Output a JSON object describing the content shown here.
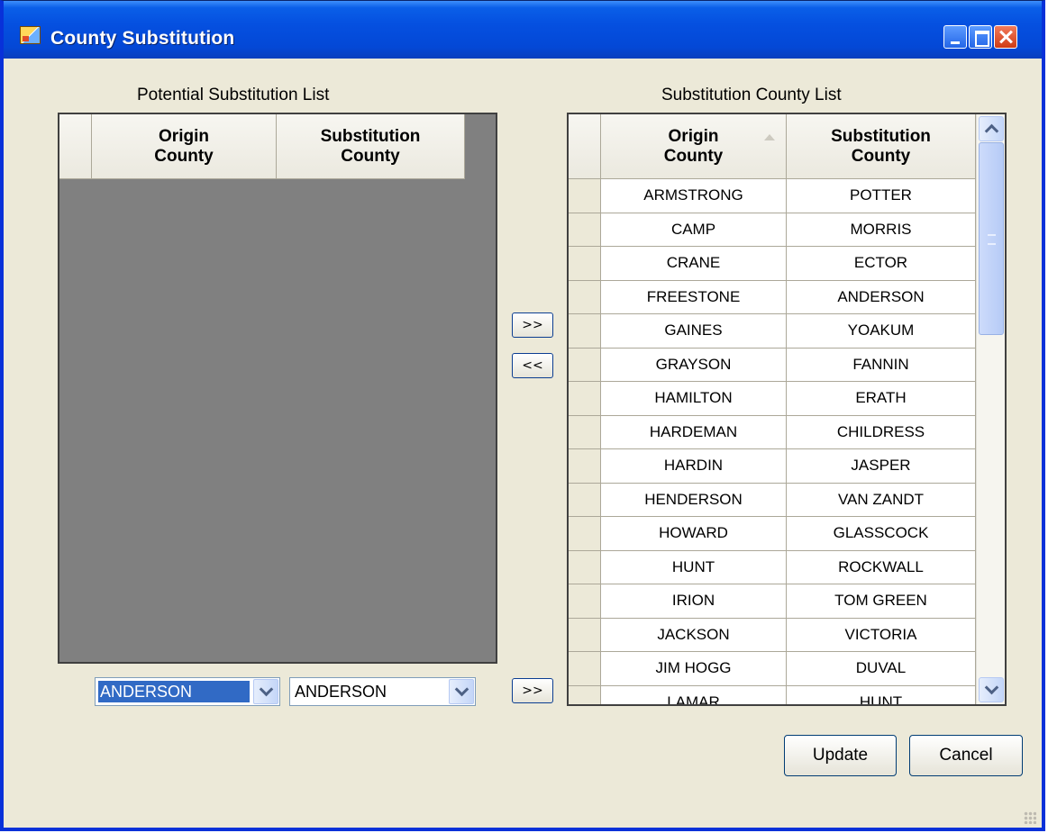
{
  "window": {
    "title": "County Substitution",
    "buttons": [
      "minimize-icon",
      "maximize-icon",
      "close-icon"
    ]
  },
  "left_panel": {
    "title": "Potential Substitution List",
    "columns": [
      "Origin\nCounty",
      "Substitution\nCounty"
    ],
    "rows": []
  },
  "right_panel": {
    "title": "Substitution County List",
    "columns": [
      "Origin\nCounty",
      "Substitution\nCounty"
    ],
    "sorted_column": "Origin County",
    "rows": [
      [
        "ARMSTRONG",
        "POTTER"
      ],
      [
        "CAMP",
        "MORRIS"
      ],
      [
        "CRANE",
        "ECTOR"
      ],
      [
        "FREESTONE",
        "ANDERSON"
      ],
      [
        "GAINES",
        "YOAKUM"
      ],
      [
        "GRAYSON",
        "FANNIN"
      ],
      [
        "HAMILTON",
        "ERATH"
      ],
      [
        "HARDEMAN",
        "CHILDRESS"
      ],
      [
        "HARDIN",
        "JASPER"
      ],
      [
        "HENDERSON",
        "VAN ZANDT"
      ],
      [
        "HOWARD",
        "GLASSCOCK"
      ],
      [
        "HUNT",
        "ROCKWALL"
      ],
      [
        "IRION",
        "TOM GREEN"
      ],
      [
        "JACKSON",
        "VICTORIA"
      ],
      [
        "JIM HOGG",
        "DUVAL"
      ],
      [
        "LAMAR",
        "HUNT"
      ]
    ]
  },
  "move_buttons": {
    "add": ">>",
    "remove": "<<",
    "add_combo": ">>"
  },
  "combos": {
    "origin": "ANDERSON",
    "substitution": "ANDERSON"
  },
  "actions": {
    "update": "Update",
    "cancel": "Cancel"
  },
  "colors": {
    "titlebar": "#0550e0",
    "window_bg": "#ece9d8",
    "empty_grid": "#808080",
    "selection": "#316ac5"
  }
}
